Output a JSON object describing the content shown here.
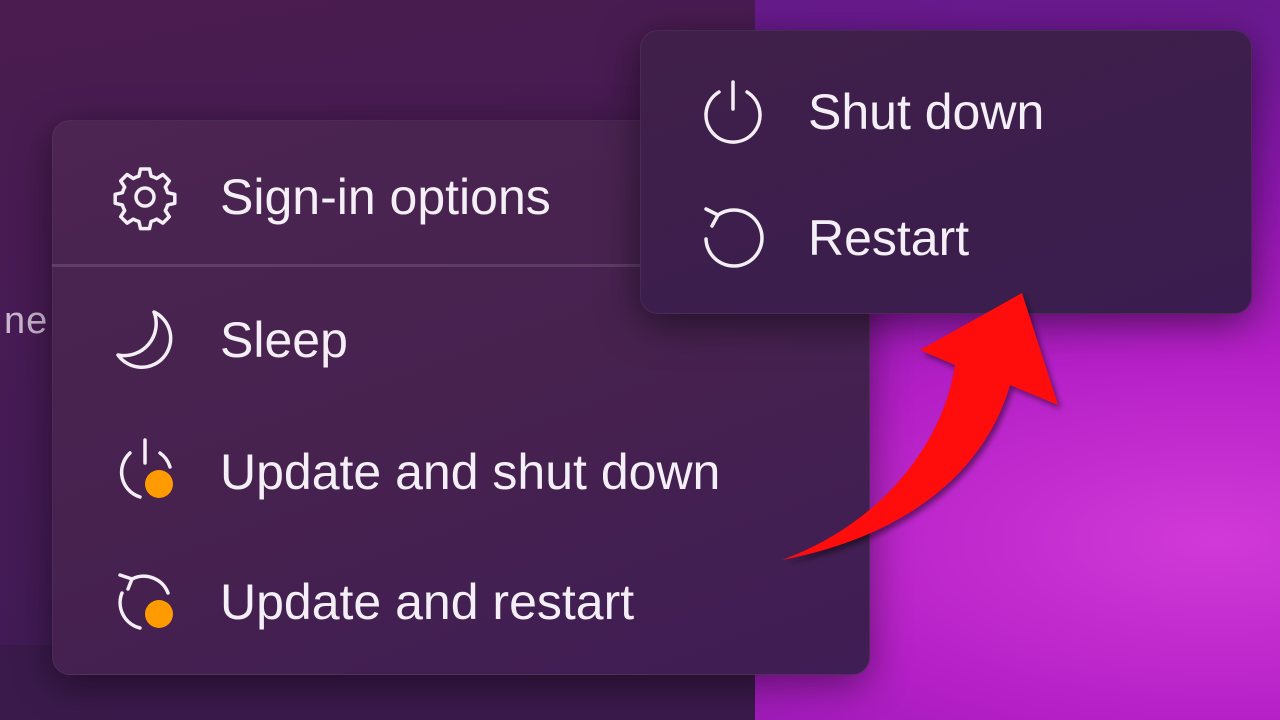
{
  "background_stub_text": "ne",
  "menu": {
    "items": [
      {
        "label": "Sign-in options",
        "icon": "gear-icon"
      },
      {
        "label": "Sleep",
        "icon": "moon-icon"
      },
      {
        "label": "Update and shut down",
        "icon": "update-shutdown-icon"
      },
      {
        "label": "Update and restart",
        "icon": "update-restart-icon"
      }
    ]
  },
  "submenu": {
    "items": [
      {
        "label": "Shut down",
        "icon": "power-icon"
      },
      {
        "label": "Restart",
        "icon": "restart-icon"
      }
    ]
  },
  "annotation": {
    "type": "arrow",
    "color": "#ff0a0a",
    "points_to": "Restart"
  },
  "colors": {
    "update_badge": "#ff9a00",
    "text": "#f4eef6",
    "annotation_arrow": "#ff0a0a"
  }
}
